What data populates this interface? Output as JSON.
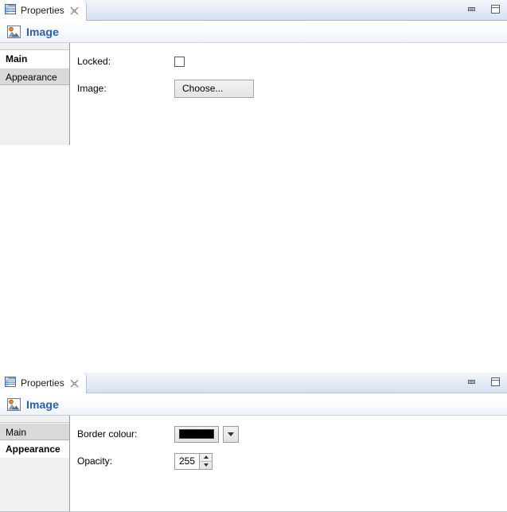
{
  "views": [
    {
      "id": "properties-view-main",
      "tab": {
        "label": "Properties",
        "icon": "properties-table-icon",
        "close_icon": "close-icon"
      },
      "window_buttons": {
        "minimize": "minimize-icon",
        "maximize": "maximize-icon"
      },
      "header": {
        "icon": "image-icon",
        "title": "Image"
      },
      "side_tabs": [
        {
          "label": "Main",
          "selected": true
        },
        {
          "label": "Appearance",
          "selected": false
        }
      ],
      "fields": [
        {
          "label": "Locked:",
          "control": "checkbox",
          "checked": false
        },
        {
          "label": "Image:",
          "control": "button",
          "value": "Choose..."
        }
      ]
    },
    {
      "id": "properties-view-appearance",
      "tab": {
        "label": "Properties",
        "icon": "properties-table-icon",
        "close_icon": "close-icon"
      },
      "window_buttons": {
        "minimize": "minimize-icon",
        "maximize": "maximize-icon"
      },
      "header": {
        "icon": "image-icon",
        "title": "Image"
      },
      "side_tabs": [
        {
          "label": "Main",
          "selected": false
        },
        {
          "label": "Appearance",
          "selected": true
        }
      ],
      "fields": [
        {
          "label": "Border colour:",
          "control": "color-picker",
          "value": "#000000",
          "dropdown_icon": "chevron-down-icon"
        },
        {
          "label": "Opacity:",
          "control": "spinner",
          "value": "255"
        }
      ]
    }
  ],
  "colors": {
    "title_blue": "#2460b4",
    "tab_gradient_top": "#f4f7fb",
    "tab_gradient_bottom": "#d6e0f0",
    "selected_tab_bg": "#d9d9d9",
    "swatch_black": "#000000"
  }
}
